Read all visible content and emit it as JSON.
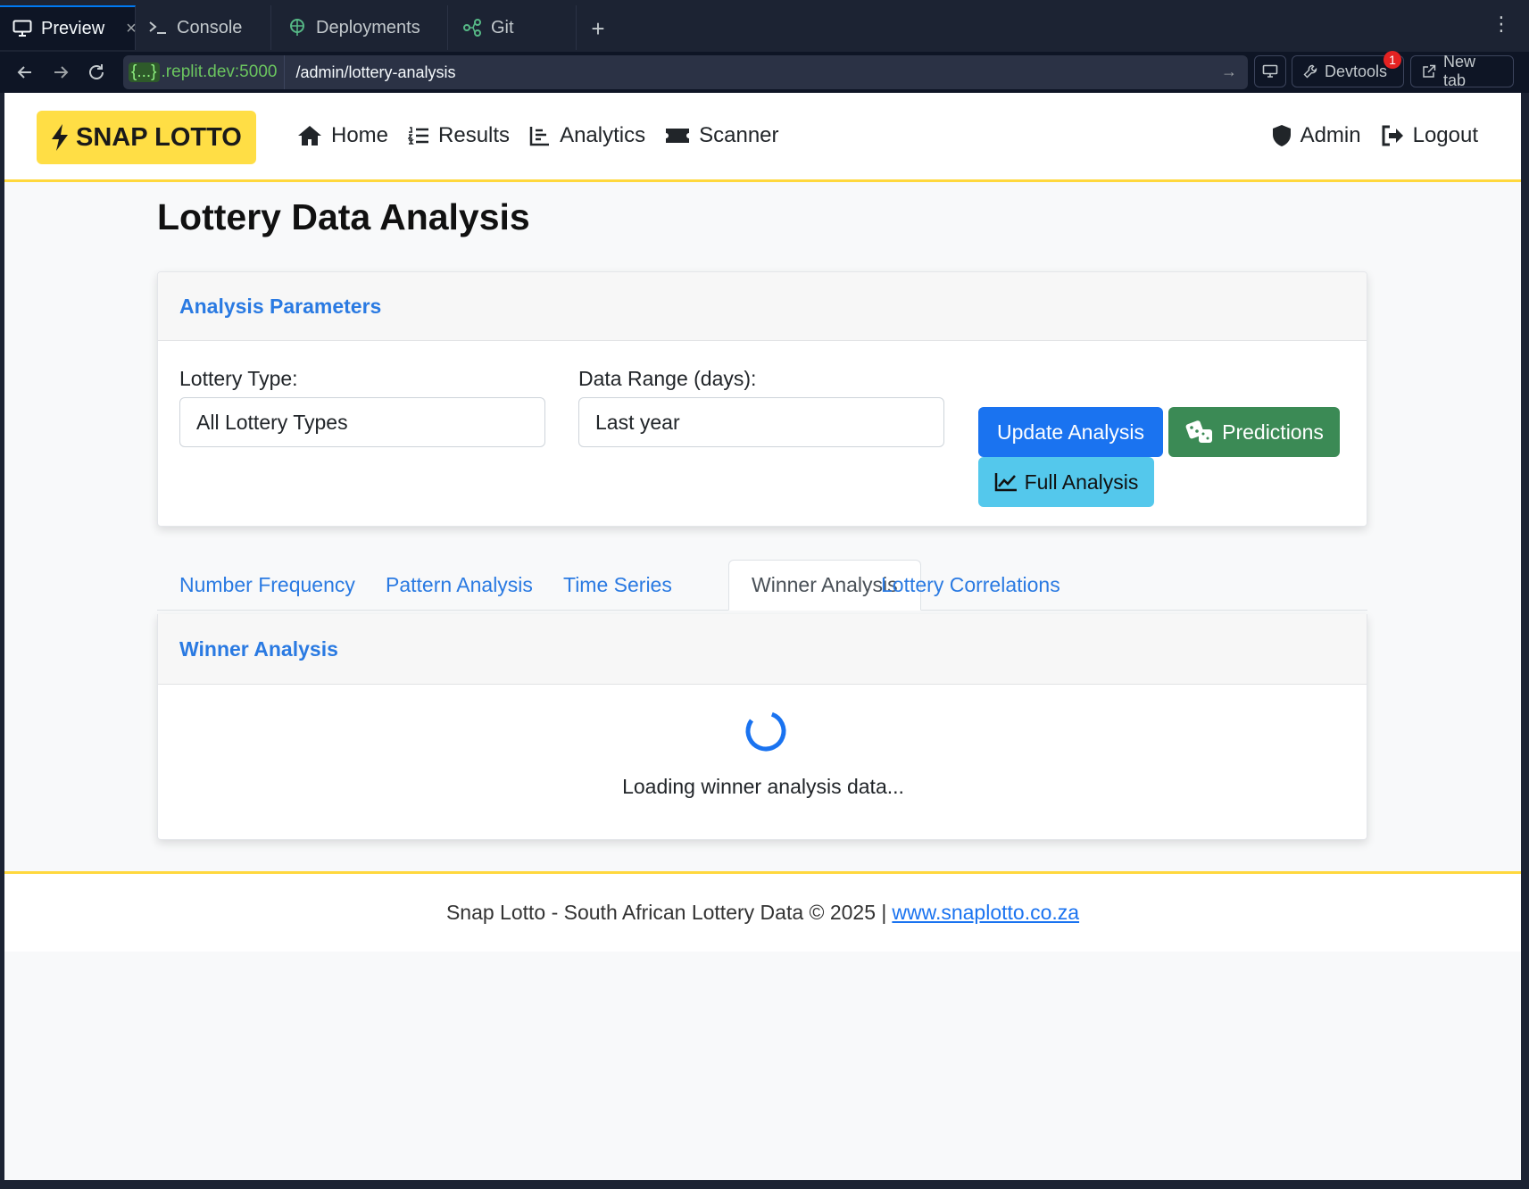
{
  "browser": {
    "tabs": [
      {
        "label": "Preview",
        "icon": "monitor-icon",
        "active": true
      },
      {
        "label": "Console",
        "icon": "terminal-icon"
      },
      {
        "label": "Deployments",
        "icon": "deployments-icon"
      },
      {
        "label": "Git",
        "icon": "git-icon"
      }
    ],
    "close_glyph": "×",
    "new_tab_glyph": "+",
    "url_tag": "{...}",
    "url_host": ".replit.dev:5000",
    "url_path": "/admin/lottery-analysis",
    "devtools_label": "Devtools",
    "devtools_badge": "1",
    "newtab_label": "New tab"
  },
  "site": {
    "brand": "SNAP LOTTO",
    "brand_color": "#ffde45",
    "nav": [
      {
        "label": "Home",
        "icon": "home-icon"
      },
      {
        "label": "Results",
        "icon": "list-ordered-icon"
      },
      {
        "label": "Analytics",
        "icon": "bar-chart-icon"
      },
      {
        "label": "Scanner",
        "icon": "ticket-icon"
      }
    ],
    "nav_right": [
      {
        "label": "Admin",
        "icon": "shield-icon"
      },
      {
        "label": "Logout",
        "icon": "logout-icon"
      }
    ]
  },
  "page": {
    "title": "Lottery Data Analysis",
    "params": {
      "header": "Analysis Parameters",
      "lottery_type_label": "Lottery Type:",
      "lottery_type_value": "All Lottery Types",
      "range_label": "Data Range (days):",
      "range_value": "Last year",
      "update_button": "Update Analysis",
      "predictions_button": "Predictions",
      "full_analysis_button": "Full Analysis"
    },
    "tabs": [
      "Number Frequency",
      "Pattern Analysis",
      "Time Series",
      "Winner Analysis",
      "Lottery Correlations"
    ],
    "active_tab": "Winner Analysis",
    "winner": {
      "header": "Winner Analysis",
      "loading_text": "Loading winner analysis data..."
    }
  },
  "footer": {
    "text": "Snap Lotto - South African Lottery Data © 2025 |",
    "link": "www.snaplotto.co.za"
  }
}
